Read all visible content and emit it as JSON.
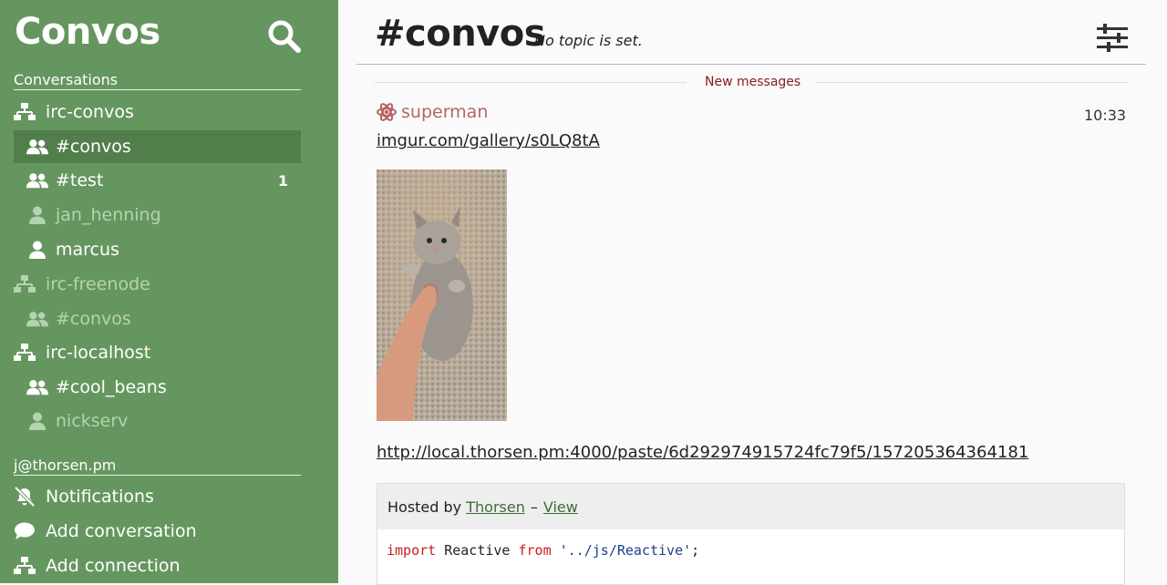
{
  "sidebar": {
    "brand": "Convos",
    "conversations_heading": "Conversations",
    "items": [
      {
        "label": "irc-convos",
        "kind": "connection",
        "dim": false
      },
      {
        "label": "#convos",
        "kind": "channel",
        "dim": false,
        "active": true
      },
      {
        "label": "#test",
        "kind": "channel",
        "dim": false,
        "count": "1"
      },
      {
        "label": "jan_henning",
        "kind": "private",
        "dim": true
      },
      {
        "label": "marcus",
        "kind": "private",
        "dim": false
      },
      {
        "label": "irc-freenode",
        "kind": "connection",
        "dim": true
      },
      {
        "label": "#convos",
        "kind": "channel",
        "dim": true
      },
      {
        "label": "irc-localhost",
        "kind": "connection",
        "dim": false
      },
      {
        "label": "#cool_beans",
        "kind": "channel",
        "dim": false
      },
      {
        "label": "nickserv",
        "kind": "private",
        "dim": true
      }
    ],
    "account_heading": "j@thorsen.pm",
    "account_items": [
      {
        "label": "Notifications",
        "icon": "bell-slash-icon"
      },
      {
        "label": "Add conversation",
        "icon": "speech-bubble-icon"
      },
      {
        "label": "Add connection",
        "icon": "network-icon"
      }
    ]
  },
  "header": {
    "title": "#convos",
    "topic": "No topic is set."
  },
  "messages": {
    "divider": "New messages",
    "author": "superman",
    "author_color": "#b56565",
    "time": "10:33",
    "link1": "imgur.com/gallery/s0LQ8tA",
    "link2": "http://local.thorsen.pm:4000/paste/6d292974915724fc79f5/157205364364181",
    "embed": {
      "hosted_by": "Hosted by",
      "author": "Thorsen",
      "separator": "–",
      "view": "View",
      "code_kw1": "import",
      "code_id": "Reactive",
      "code_kw2": "from",
      "code_str": "'../js/Reactive'",
      "code_end": ";"
    }
  },
  "colors": {
    "sidebar_bg": "#66965f",
    "sidebar_active": "#527e4c",
    "dim_text": "#b5d3b0",
    "divider_text": "#8b1a1a"
  }
}
